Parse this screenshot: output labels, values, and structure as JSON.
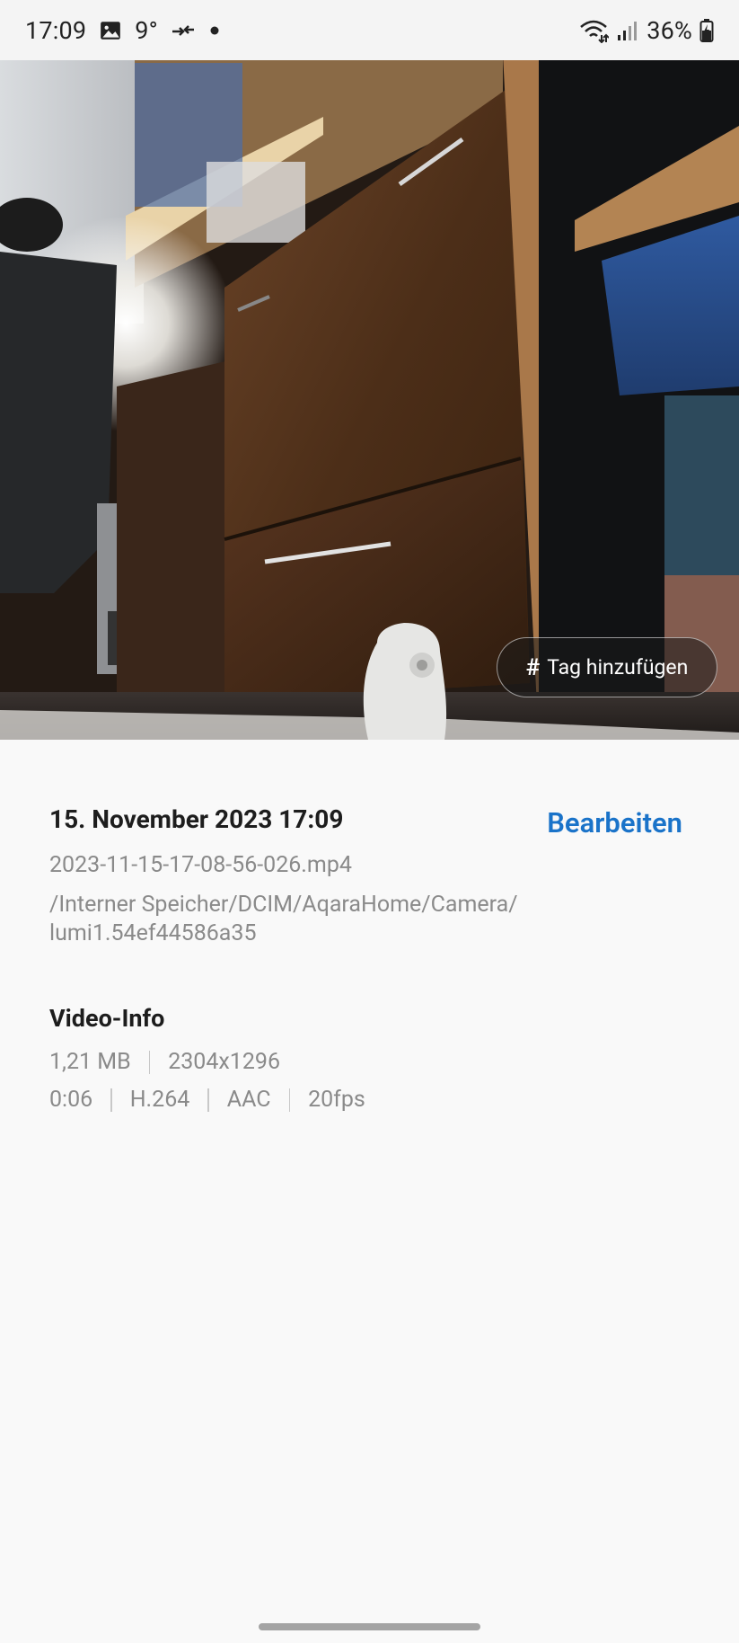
{
  "status_bar": {
    "time": "17:09",
    "temperature": "9°",
    "battery_percent": "36%",
    "icons": [
      "image-icon",
      "data-transfer-icon",
      "dot-icon",
      "wifi-icon",
      "signal-icon",
      "battery-icon"
    ]
  },
  "photo": {
    "tag_button_label": "Tag hinzufügen",
    "tag_button_symbol": "#"
  },
  "details": {
    "date_time": "15. November 2023 17:09",
    "edit_label": "Bearbeiten",
    "filename": "2023-11-15-17-08-56-026.mp4",
    "path_line1": "/Interner Speicher/DCIM/AqaraHome/Camera/",
    "path_line2": "lumi1.54ef44586a35"
  },
  "video_info": {
    "title": "Video-Info",
    "size": "1,21 MB",
    "resolution": "2304x1296",
    "duration": "0:06",
    "video_codec": "H.264",
    "audio_codec": "AAC",
    "framerate": "20fps"
  },
  "colors": {
    "accent": "#1a73c9",
    "background": "#f9f9f9",
    "secondary_text": "#8a8a8a",
    "primary_text": "#1d1d1d"
  }
}
